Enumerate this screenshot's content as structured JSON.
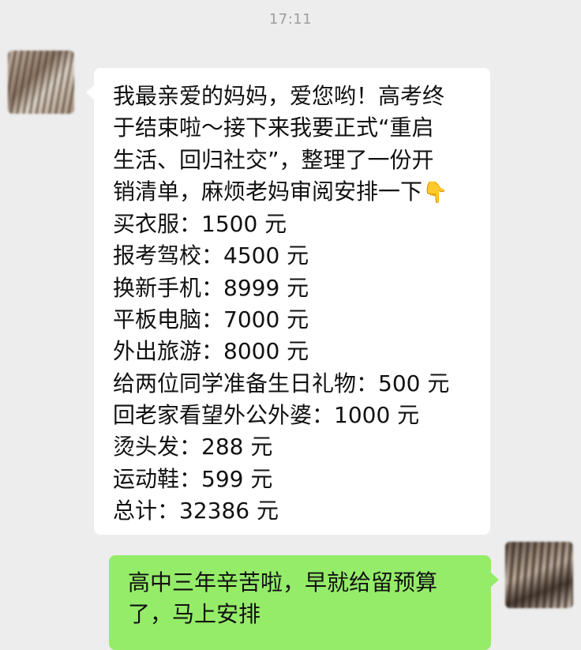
{
  "chat": {
    "timestamp": "17:11",
    "incoming": {
      "avatar": "blurred-profile-photo",
      "intro_lines": [
        "我最亲爱的妈妈，爱您哟！高考终",
        "于结束啦～接下来我要正式“重启",
        "生活、回归社交”，整理了一份开",
        "销清单，麻烦老妈审阅安排一下"
      ],
      "intro_emoji": "👇",
      "items": [
        "买衣服：1500 元",
        "报考驾校：4500 元",
        "换新手机：8999 元",
        "平板电脑：7000 元",
        "外出旅游：8000 元",
        "给两位同学准备生日礼物：500 元",
        "回老家看望外公外婆：1000 元",
        "烫头发：288 元",
        "运动鞋：599 元",
        "总计：32386 元"
      ]
    },
    "outgoing": {
      "avatar": "blurred-profile-photo",
      "lines": [
        "高中三年辛苦啦，早就给留预算",
        "了，马上安排"
      ]
    }
  },
  "colors": {
    "background": "#ededed",
    "incoming_bubble": "#ffffff",
    "outgoing_bubble": "#95ec69",
    "timestamp_text": "#9e9e9e",
    "message_text": "#111111"
  }
}
